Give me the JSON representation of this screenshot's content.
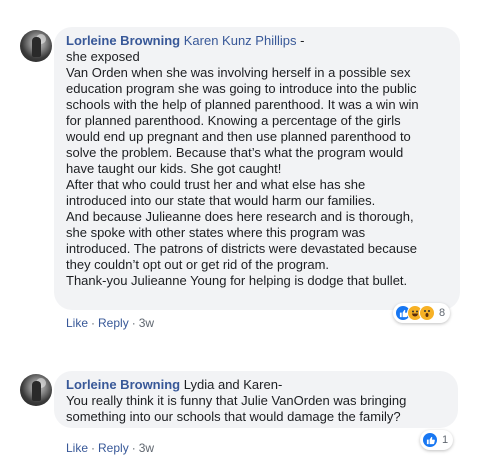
{
  "comments": [
    {
      "author": "Lorleine Browning",
      "mention": "Karen Kunz Phillips",
      "mention_suffix": " -",
      "lines": [
        "she exposed",
        "Van Orden when she was involving herself in a possible sex",
        "education program she was going to introduce into the public",
        "schools with the help of planned parenthood. It was a win win",
        "for planned parenthood. Knowing a percentage of the girls",
        "would end up pregnant and then use planned parenthood to",
        "solve the problem. Because that’s what the program would",
        "have taught our kids. She got caught!",
        "After that who could trust her and what else has she",
        "introduced into our state that would harm our families.",
        "And because Julieanne does here research and is thorough,",
        "she spoke with other states where this program was",
        "introduced. The patrons of districts were devastated because",
        "they couldn’t opt out or get rid of the program.",
        "Thank-you Julieanne Young for helping is dodge that bullet."
      ],
      "actions": {
        "like": "Like",
        "reply": "Reply",
        "time": "3w",
        "sep": "·"
      },
      "reactions": {
        "icons": [
          "like-icon",
          "haha-icon",
          "wow-icon"
        ],
        "count": "8"
      }
    },
    {
      "author": "Lorleine Browning",
      "mention": "",
      "mention_suffix": "",
      "first_line_rest": "Lydia and Karen-",
      "lines": [
        "You really think it is funny that Julie VanOrden was bringing",
        "something into our schools that would damage the family?"
      ],
      "actions": {
        "like": "Like",
        "reply": "Reply",
        "time": "3w",
        "sep": "·"
      },
      "reactions": {
        "icons": [
          "like-icon"
        ],
        "count": "1"
      }
    }
  ],
  "colors": {
    "link": "#385898",
    "bubble": "#f2f3f5",
    "like": "#1877f2",
    "emoji": "#f7b125"
  }
}
